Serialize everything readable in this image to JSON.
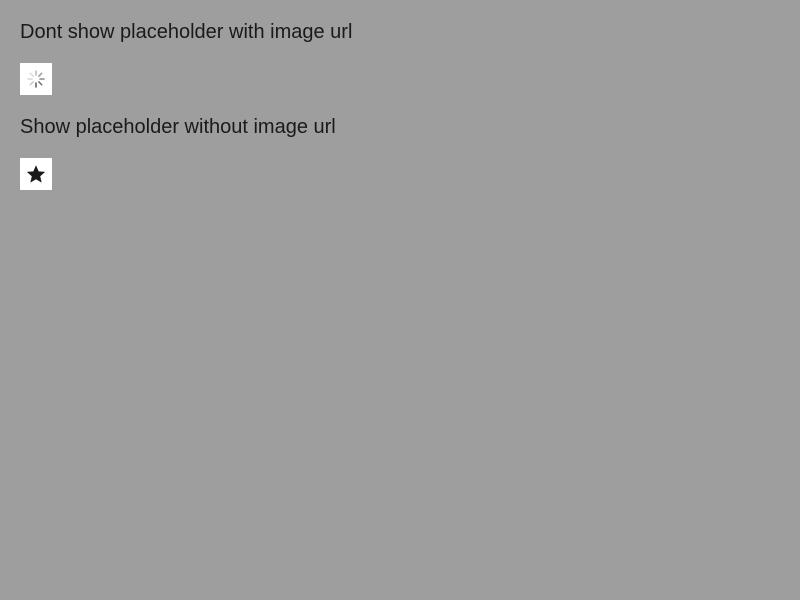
{
  "sections": [
    {
      "label": "Dont show placeholder with image url",
      "indicator_icon": "loading-spinner-icon"
    },
    {
      "label": "Show placeholder without image url",
      "indicator_icon": "star-icon"
    }
  ],
  "colors": {
    "background": "#9e9e9e",
    "tile": "#ffffff",
    "text": "#1a1a1a",
    "star": "#1a1a1a"
  }
}
